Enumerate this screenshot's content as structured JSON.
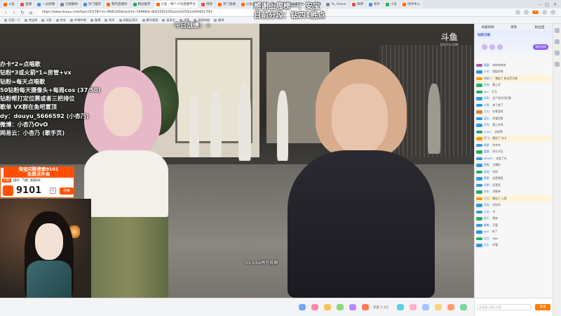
{
  "browser": {
    "tabs": [
      {
        "label": "斗鱼",
        "color": "#ff6a00"
      },
      {
        "label": "直播",
        "color": "#e34d4d"
      },
      {
        "label": "一过就懂",
        "color": "#4a90e2"
      },
      {
        "label": "已被删除",
        "color": "#7c8a99"
      },
      {
        "label": "热门推荐",
        "color": "#4a90e2"
      },
      {
        "label": "我的直播间",
        "color": "#ff6a00"
      },
      {
        "label": "精品推荐",
        "color": "#27ae60"
      },
      {
        "label": "斗鱼 - 每个人的直播平台",
        "color": "#ff6a00"
      },
      {
        "label": "视频",
        "color": "#e34d4d"
      },
      {
        "label": "热门直播",
        "color": "#ff6a00"
      },
      {
        "label": "斗鱼直播",
        "color": "#ff6a00"
      },
      {
        "label": "斗鱼 - 每个人的直播平台",
        "color": "#ff6a00"
      },
      {
        "label": "在线",
        "color": "#4a90e2"
      },
      {
        "label": "Yu_Xiaom",
        "color": "#7c8a99"
      },
      {
        "label": "微博",
        "color": "#e34d4d"
      },
      {
        "label": "知乎",
        "color": "#4a90e2"
      },
      {
        "label": "小说",
        "color": "#27ae60"
      },
      {
        "label": "创作中心",
        "color": "#ff6a00"
      }
    ],
    "active_tab_index": 7,
    "url": "https://www.douyu.com/topic/SYLTB?rid=9685266&dyshid=56968dc-802558210f5aa3c025f21e0000017f01",
    "bookmarks": [
      "百度一下",
      "淘宝网",
      "斗鱼",
      "京东",
      "哔哩哔哩",
      "微博",
      "知乎",
      "网易云音乐",
      "腾讯视频",
      "爱奇艺",
      "优酷",
      "高德地图",
      "翻译"
    ],
    "badge": "5"
  },
  "stream": {
    "overlay_top1": "感谢上周榜一：安宝",
    "overlay_top2": "目前分段：钻四1胜点",
    "overlay_today": "今日战绩：☆",
    "menu_lines": [
      "办卡*2=点唱歌",
      "钻粉*3或火箭*1=房管+vx",
      "钻粉=每天点唱歌",
      "50钻粉每天摄像头+每周cos (37/50)",
      "钻粉帮打定位赛或者三把排位",
      "歌单 VX群在鱼吧置顶",
      "dy：douyu_5666592 (小杏乃)",
      "微博：小杏乃OvO",
      "网易云：小杏乃 (歌手页)"
    ],
    "caption": "his vibe再写首曲",
    "watermark": "斗鱼",
    "watermark_sub": "DOUYU.COM"
  },
  "ad": {
    "title": "淘宝闪购搜索9101",
    "subtitle": "免费点外卖",
    "chips": [
      "闪购",
      "国补",
      "飞猪",
      "超级88"
    ],
    "code": "9101",
    "search_label": "搜索"
  },
  "playerbar": {
    "viewer_count": "热度 1.5亿",
    "status": "正在播放"
  },
  "side": {
    "tabs": [
      "贡献日榜",
      "贵宾",
      "粉丝团"
    ],
    "rank_title": "钻粉日榜",
    "rank_pill": "我的钻粉",
    "chat": [
      {
        "nick": "蛋蛋：",
        "text": "哈哈哈哈哈",
        "color": "#9b59b6",
        "gift": false
      },
      {
        "nick": "小羊：",
        "text": "姐姐好美",
        "color": "#3498db",
        "gift": false
      },
      {
        "nick": "神秘人：",
        "text": "赠送了 粉丝荧光棒",
        "color": "#f39c12",
        "gift": true
      },
      {
        "nick": "阿杰：",
        "text": "晚上好",
        "color": "#27ae60",
        "gift": false
      },
      {
        "nick": "Yan：",
        "text": "打卡",
        "color": "#27ae60",
        "gift": false
      },
      {
        "nick": "风吹：",
        "text": "这个地方好好看",
        "color": "#3498db",
        "gift": false
      },
      {
        "nick": "小鱼：",
        "text": "来了来了",
        "color": "#3498db",
        "gift": false
      },
      {
        "nick": "大大：",
        "text": "在哪里呀",
        "color": "#e67e22",
        "gift": false
      },
      {
        "nick": "蓝天：",
        "text": "好看好看",
        "color": "#3498db",
        "gift": false
      },
      {
        "nick": "月亮：",
        "text": "晚上好呀",
        "color": "#3498db",
        "gift": false
      },
      {
        "nick": "ryyyy：",
        "text": "这谁啊",
        "color": "#27ae60",
        "gift": false
      },
      {
        "nick": "阿飞：",
        "text": "赠送了 办卡",
        "color": "#f39c12",
        "gift": true
      },
      {
        "nick": "星星：",
        "text": "冲冲冲",
        "color": "#3498db",
        "gift": false
      },
      {
        "nick": "晨晨：",
        "text": "好久不见",
        "color": "#27ae60",
        "gift": false
      },
      {
        "nick": "MOMO：",
        "text": "吃饭了吗",
        "color": "#3498db",
        "gift": false
      },
      {
        "nick": "夜猫：",
        "text": "主播好",
        "color": "#3498db",
        "gift": false
      },
      {
        "nick": "胖虎：",
        "text": "哈哈",
        "color": "#27ae60",
        "gift": false
      },
      {
        "nick": "果果：",
        "text": "这是哪里",
        "color": "#3498db",
        "gift": false
      },
      {
        "nick": "阿明：",
        "text": "好漂亮",
        "color": "#3498db",
        "gift": false
      },
      {
        "nick": "木木：",
        "text": "求歌单",
        "color": "#27ae60",
        "gift": false
      },
      {
        "nick": "七七：",
        "text": "赠送了 火箭",
        "color": "#f39c12",
        "gift": true
      },
      {
        "nick": "凉凉：",
        "text": "好好好",
        "color": "#3498db",
        "gift": false
      },
      {
        "nick": "小白：",
        "text": "冲",
        "color": "#3498db",
        "gift": false
      },
      {
        "nick": "老王：",
        "text": "晚安",
        "color": "#27ae60",
        "gift": false
      },
      {
        "nick": "嘟嘟：",
        "text": "可爱",
        "color": "#3498db",
        "gift": false
      },
      {
        "nick": "Kiki：",
        "text": "来了",
        "color": "#3498db",
        "gift": false
      },
      {
        "nick": "豆豆：",
        "text": "666",
        "color": "#27ae60",
        "gift": false
      },
      {
        "nick": "乐乐：",
        "text": "好看",
        "color": "#3498db",
        "gift": false
      }
    ],
    "input_placeholder": "这里输入聊天内容",
    "send_label": "发送"
  }
}
